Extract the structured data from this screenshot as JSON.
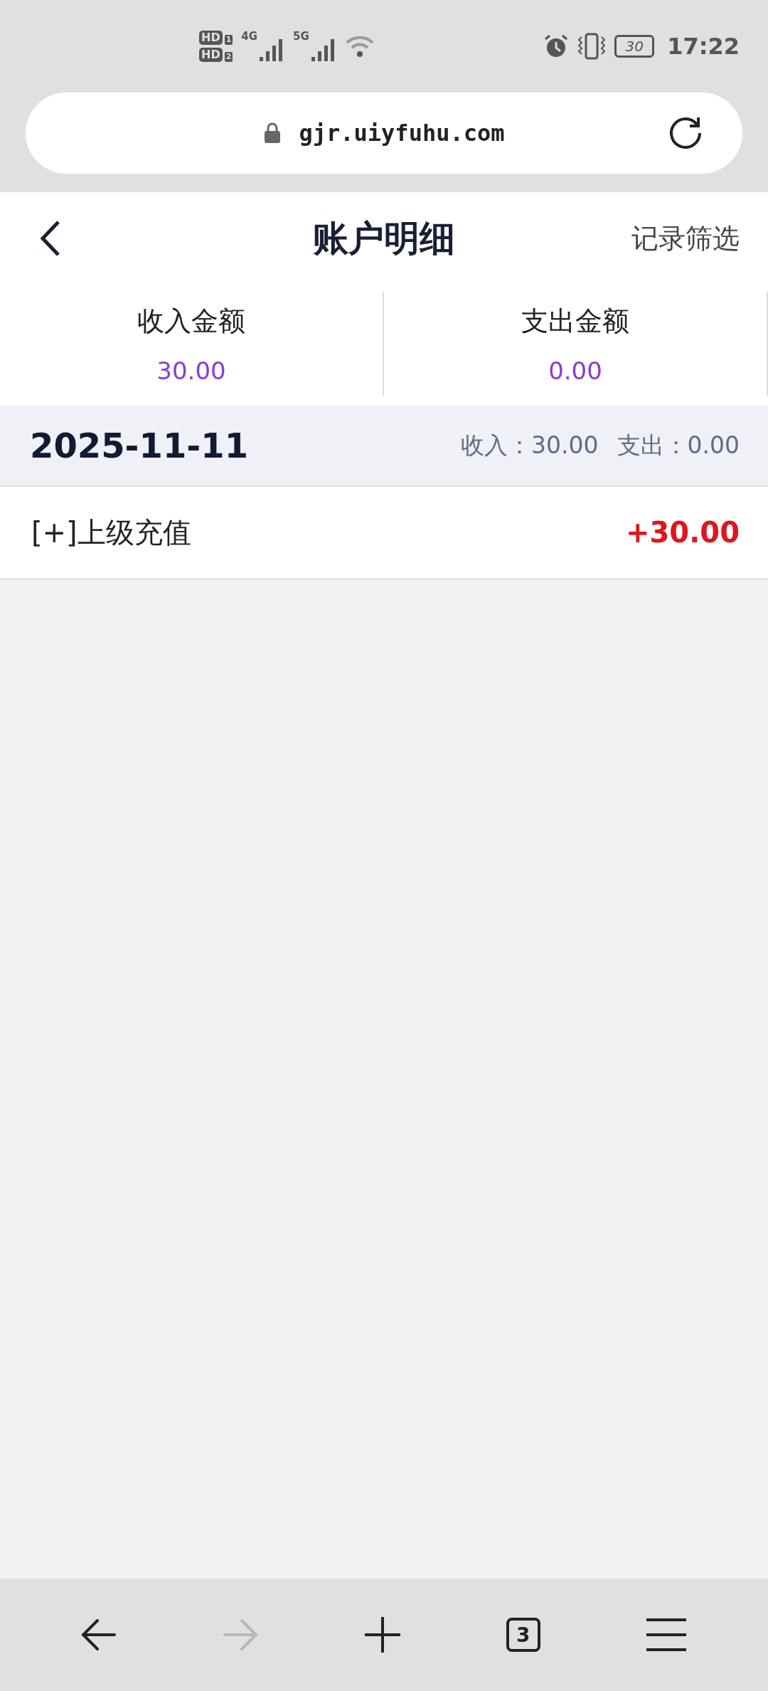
{
  "status_bar": {
    "sims": [
      {
        "label": "HD",
        "slot": "1"
      },
      {
        "label": "HD",
        "slot": "2"
      }
    ],
    "networks": [
      "4G",
      "5G"
    ],
    "battery": "30",
    "time": "17:22"
  },
  "browser": {
    "url": "gjr.uiyfuhu.com"
  },
  "header": {
    "title": "账户明细",
    "action": "记录筛选"
  },
  "summary": [
    {
      "label": "收入金额",
      "value": "30.00"
    },
    {
      "label": "支出金额",
      "value": "0.00"
    }
  ],
  "groups": [
    {
      "date": "2025-11-11",
      "income": "收入：30.00",
      "expense": "支出：0.00",
      "records": [
        {
          "title": "[+]上级充值",
          "amount": "+30.00"
        }
      ]
    }
  ],
  "bottom_nav": {
    "tabs_count": "3",
    "forward_disabled": true
  }
}
